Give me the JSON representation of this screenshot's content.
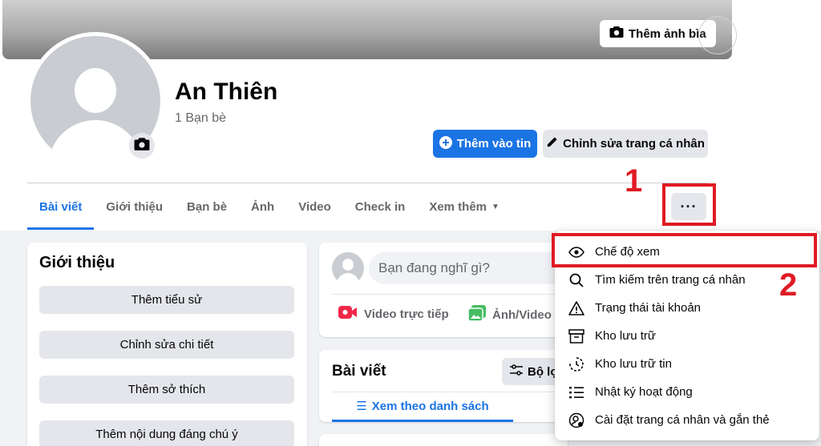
{
  "cover": {
    "add_cover_label": "Thêm ảnh bìa"
  },
  "profile": {
    "name": "An Thiên",
    "friends_count": "1 Bạn bè"
  },
  "actions": {
    "add_to_story": "Thêm vào tin",
    "edit_profile": "Chỉnh sửa trang cá nhân"
  },
  "tabs": [
    {
      "label": "Bài viết",
      "active": true
    },
    {
      "label": "Giới thiệu"
    },
    {
      "label": "Bạn bè"
    },
    {
      "label": "Ảnh"
    },
    {
      "label": "Video"
    },
    {
      "label": "Check in"
    },
    {
      "label": "Xem thêm"
    }
  ],
  "more_button": {
    "label": "···"
  },
  "annotations": {
    "step1": "1",
    "step2": "2",
    "highlight_color": "#e01b24"
  },
  "intro": {
    "title": "Giới thiệu",
    "buttons": [
      "Thêm tiểu sử",
      "Chỉnh sửa chi tiết",
      "Thêm sở thích",
      "Thêm nội dung đáng chú ý"
    ]
  },
  "composer": {
    "placeholder": "Bạn đang nghĩ gì?",
    "live_video": "Video trực tiếp",
    "photo_video": "Ảnh/Video"
  },
  "posts": {
    "title": "Bài viết",
    "filter": "Bộ lọc",
    "list_view": "Xem theo danh sách"
  },
  "menu": {
    "items": [
      {
        "label": "Chế độ xem",
        "icon": "eye-icon"
      },
      {
        "label": "Tìm kiếm trên trang cá nhân",
        "icon": "search-icon"
      },
      {
        "label": "Trạng thái tài khoản",
        "icon": "warning-icon"
      },
      {
        "label": "Kho lưu trữ",
        "icon": "archive-icon"
      },
      {
        "label": "Kho lưu trữ tin",
        "icon": "story-archive-icon"
      },
      {
        "label": "Nhật ký hoạt động",
        "icon": "activity-log-icon"
      },
      {
        "label": "Cài đặt trang cá nhân và gắn thẻ",
        "icon": "profile-settings-icon"
      }
    ]
  },
  "colors": {
    "brand_blue": "#1b74e4",
    "secondary_gray": "#e4e6eb",
    "page_bg": "#f0f2f5"
  }
}
